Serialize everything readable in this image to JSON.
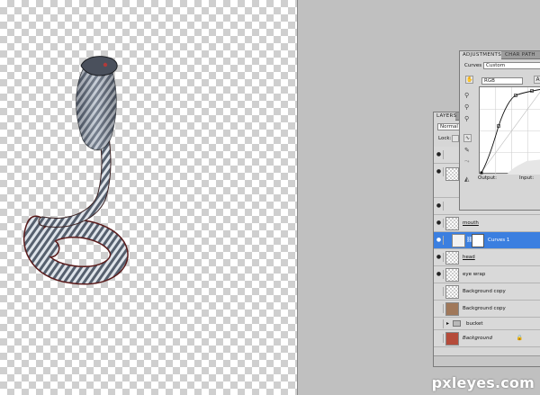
{
  "adjustments": {
    "tabs": [
      "ADJUSTMENTS",
      "CHAR PATH"
    ],
    "preset_label": "Curves",
    "preset_value": "Custom",
    "channel_value": "RGB",
    "auto_label": "A",
    "output_label": "Output:",
    "input_label": "Input:"
  },
  "layers": {
    "tab": "LAYERS",
    "blend_mode": "Normal",
    "lock_label": "Lock:",
    "rows": [
      {
        "name": "mouth"
      },
      {
        "name": "Curves 1"
      },
      {
        "name": "head"
      },
      {
        "name": "eye wrap"
      },
      {
        "name": "Background copy"
      },
      {
        "name": "Background copy"
      },
      {
        "name": "bucket"
      },
      {
        "name": "Background"
      }
    ]
  },
  "watermark": "pxleyes.com",
  "colors": {
    "selection": "#3b7fe0",
    "panel_bg": "#d6d6d6",
    "workspace": "#c0c0c0"
  },
  "icons": [
    "eye-icon",
    "folder-icon",
    "lock-icon",
    "eyedropper-icon",
    "hand-icon",
    "pencil-icon",
    "curve-icon",
    "link-icon",
    "trash-icon"
  ]
}
